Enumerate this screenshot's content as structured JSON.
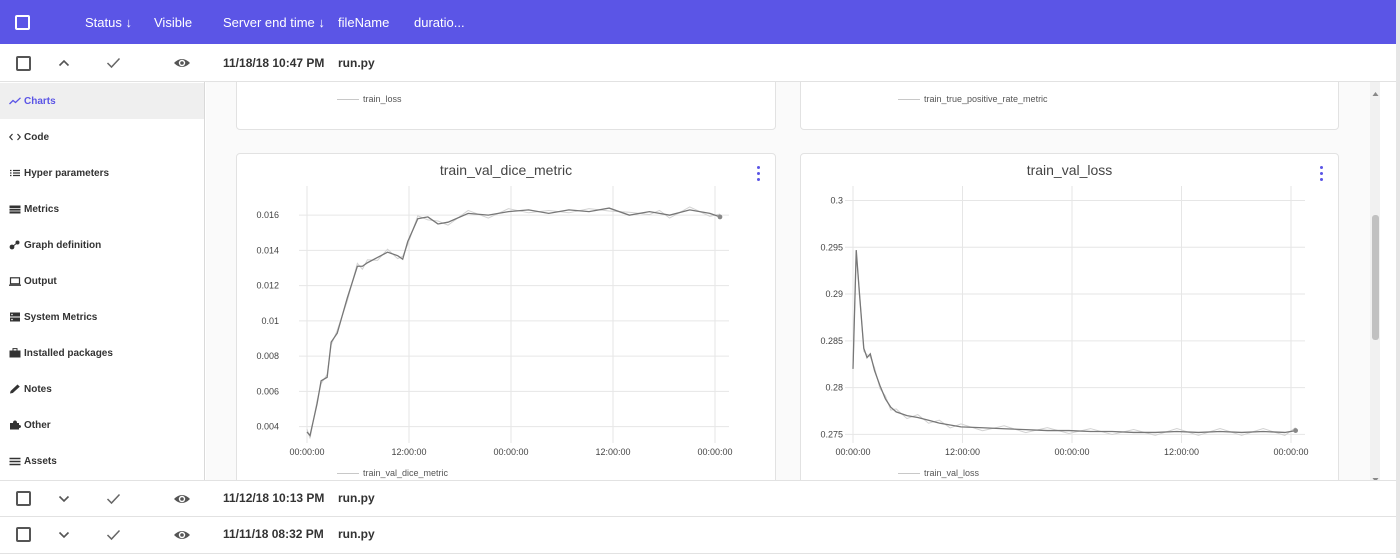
{
  "header": {
    "status": "Status ↓",
    "visible": "Visible",
    "server_end_time": "Server end time ↓",
    "file_name": "fileName",
    "duration": "duratio..."
  },
  "runs": [
    {
      "date": "11/18/18 10:47 PM",
      "file": "run.py",
      "expanded": true
    },
    {
      "date": "11/12/18 10:13 PM",
      "file": "run.py",
      "expanded": false
    },
    {
      "date": "11/11/18 08:32 PM",
      "file": "run.py",
      "expanded": false
    }
  ],
  "sidebar": {
    "items": [
      {
        "label": "Charts",
        "icon": "line-chart-icon",
        "active": true
      },
      {
        "label": "Code",
        "icon": "code-icon"
      },
      {
        "label": "Hyper parameters",
        "icon": "list-icon"
      },
      {
        "label": "Metrics",
        "icon": "table-icon"
      },
      {
        "label": "Graph definition",
        "icon": "graph-icon"
      },
      {
        "label": "Output",
        "icon": "laptop-icon"
      },
      {
        "label": "System Metrics",
        "icon": "server-icon"
      },
      {
        "label": "Installed packages",
        "icon": "briefcase-icon"
      },
      {
        "label": "Notes",
        "icon": "pencil-icon"
      },
      {
        "label": "Other",
        "icon": "puzzle-icon"
      },
      {
        "label": "Assets",
        "icon": "menu-icon"
      }
    ]
  },
  "top_cards": [
    {
      "legend": "train_loss"
    },
    {
      "legend": "train_true_positive_rate_metric"
    }
  ],
  "colors": {
    "accent": "#5b55e6",
    "series": "#777777",
    "raw_series": "#d2d2d2",
    "grid": "#e6e6e6"
  },
  "chart_data": [
    {
      "type": "line",
      "title": "train_val_dice_metric",
      "legend": "train_val_dice_metric",
      "x_ticks": [
        "00:00:00",
        "12:00:00",
        "00:00:00",
        "12:00:00",
        "00:00:00"
      ],
      "y_ticks": [
        "0.004",
        "0.006",
        "0.008",
        "0.01",
        "0.012",
        "0.014",
        "0.016"
      ],
      "ylim": [
        0.0033,
        0.0172
      ],
      "series": [
        {
          "x": [
            0,
            0.3,
            1,
            1.4,
            2,
            2.4,
            3,
            4,
            5,
            5.5,
            6,
            7,
            8,
            9,
            9.5,
            10,
            11,
            12,
            13,
            14,
            16,
            18,
            20,
            22,
            24,
            26,
            28,
            30,
            32,
            34,
            35,
            36,
            38,
            40,
            41
          ],
          "y": [
            0.0037,
            0.0035,
            0.0053,
            0.0066,
            0.0068,
            0.0088,
            0.0093,
            0.0113,
            0.0131,
            0.0131,
            0.0133,
            0.0136,
            0.0139,
            0.0137,
            0.0135,
            0.0145,
            0.0158,
            0.0159,
            0.0155,
            0.0156,
            0.0161,
            0.016,
            0.0162,
            0.0163,
            0.0161,
            0.0163,
            0.0162,
            0.0164,
            0.016,
            0.0162,
            0.0161,
            0.016,
            0.0163,
            0.0161,
            0.0159
          ]
        }
      ]
    },
    {
      "type": "line",
      "title": "train_val_loss",
      "legend": "train_val_loss",
      "x_ticks": [
        "00:00:00",
        "12:00:00",
        "00:00:00",
        "12:00:00",
        "00:00:00"
      ],
      "y_ticks": [
        "0.275",
        "0.28",
        "0.285",
        "0.29",
        "0.295",
        "0.3"
      ],
      "ylim": [
        0.2745,
        0.3007
      ],
      "series": [
        {
          "x": [
            0,
            0.3,
            0.6,
            1,
            1.3,
            1.6,
            2,
            2.5,
            3,
            3.5,
            4,
            5,
            6,
            7,
            8,
            9,
            10,
            12,
            14,
            16,
            18,
            20,
            22,
            24,
            26,
            28,
            30,
            32,
            34,
            36,
            38,
            40,
            41
          ],
          "y": [
            0.282,
            0.2947,
            0.29,
            0.2842,
            0.2832,
            0.2836,
            0.2818,
            0.2802,
            0.2788,
            0.2779,
            0.2774,
            0.277,
            0.2768,
            0.2765,
            0.2762,
            0.276,
            0.2758,
            0.2757,
            0.2756,
            0.2755,
            0.2754,
            0.2754,
            0.2753,
            0.2753,
            0.2752,
            0.2752,
            0.2753,
            0.2752,
            0.2753,
            0.2752,
            0.2753,
            0.2752,
            0.2754
          ]
        }
      ]
    }
  ]
}
